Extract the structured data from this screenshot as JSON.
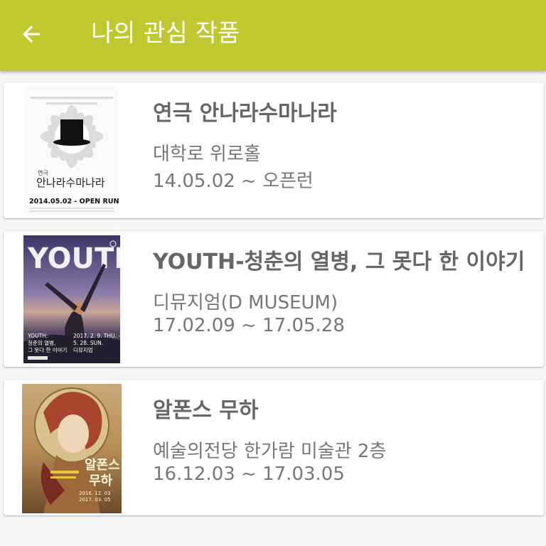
{
  "header": {
    "title": "나의 관심 작품",
    "back_icon": "arrow-left-icon",
    "background": "#bfc92f"
  },
  "items": [
    {
      "title": "연극 안나라수마나라",
      "venue": "대학로 위로홀",
      "dates": "14.05.02 ~ 오픈런",
      "poster": {
        "icon": "top-hat-poster",
        "kicker": "연극",
        "title": "안나라수마나라",
        "caption": "2014.05.02 - OPEN RUN"
      }
    },
    {
      "title": "YOUTH-청춘의 열병, 그 못다 한 이야기",
      "venue": "디뮤지엄(D MUSEUM)",
      "dates": "17.02.09 ~ 17.05.28",
      "poster": {
        "icon": "youth-poster",
        "headline": "YOUTH",
        "subtitle_1": "YOUTH:",
        "subtitle_2": "청춘의 열병,",
        "subtitle_3": "그 못다 한 이야기",
        "date_1": "2017. 2. 9. THU. —",
        "date_2": "5. 28. SUN.",
        "place": "디뮤지엄"
      }
    },
    {
      "title": "알폰스 무하",
      "venue": "예술의전당 한가람 미술관 2층",
      "dates": "16.12.03 ~ 17.03.05",
      "poster": {
        "icon": "mucha-poster",
        "title_1": "알폰스",
        "title_2": "무하",
        "date_1": "2016. 12. 03",
        "date_2": "2017. 03. 05"
      }
    }
  ]
}
